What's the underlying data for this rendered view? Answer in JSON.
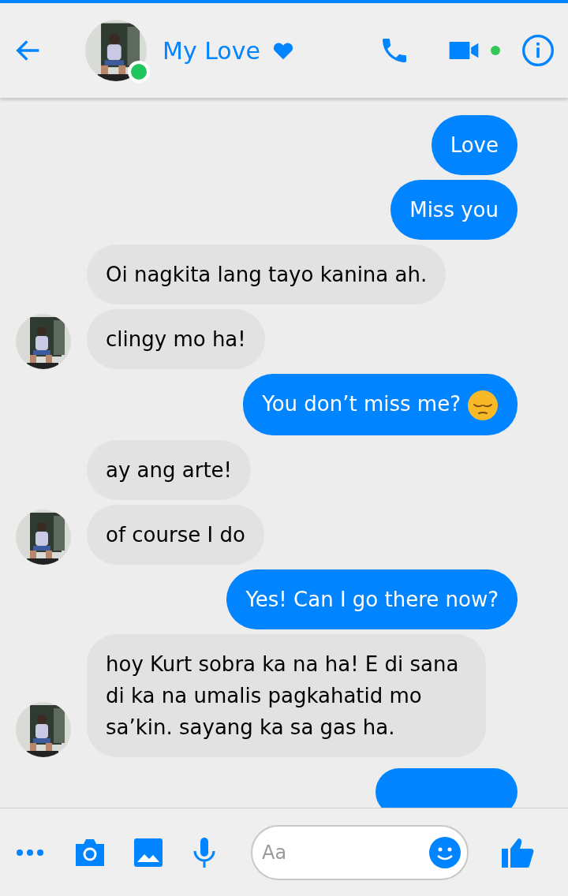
{
  "header": {
    "name": "My Love",
    "online": true,
    "video_active": true
  },
  "messages": [
    {
      "kind": "sent",
      "text": "Love"
    },
    {
      "kind": "sent",
      "text": "Miss you"
    },
    {
      "kind": "received",
      "text": "Oi nagkita lang tayo kanina ah.",
      "show_avatar": false
    },
    {
      "kind": "received",
      "text": "clingy mo ha!",
      "show_avatar": true
    },
    {
      "kind": "sent_emoji",
      "text": "You don’t miss me?"
    },
    {
      "kind": "received",
      "text": "ay ang arte!",
      "show_avatar": false
    },
    {
      "kind": "received",
      "text": "of course I do",
      "show_avatar": true
    },
    {
      "kind": "sent",
      "text": "Yes! Can I go there now?"
    },
    {
      "kind": "received",
      "text": "hoy Kurt sobra ka na ha! E di sana di ka na umalis pagkahatid mo sa’kin. sayang ka sa gas ha.",
      "show_avatar": true
    },
    {
      "kind": "sent_partial"
    }
  ],
  "composer": {
    "placeholder": "Aa"
  }
}
